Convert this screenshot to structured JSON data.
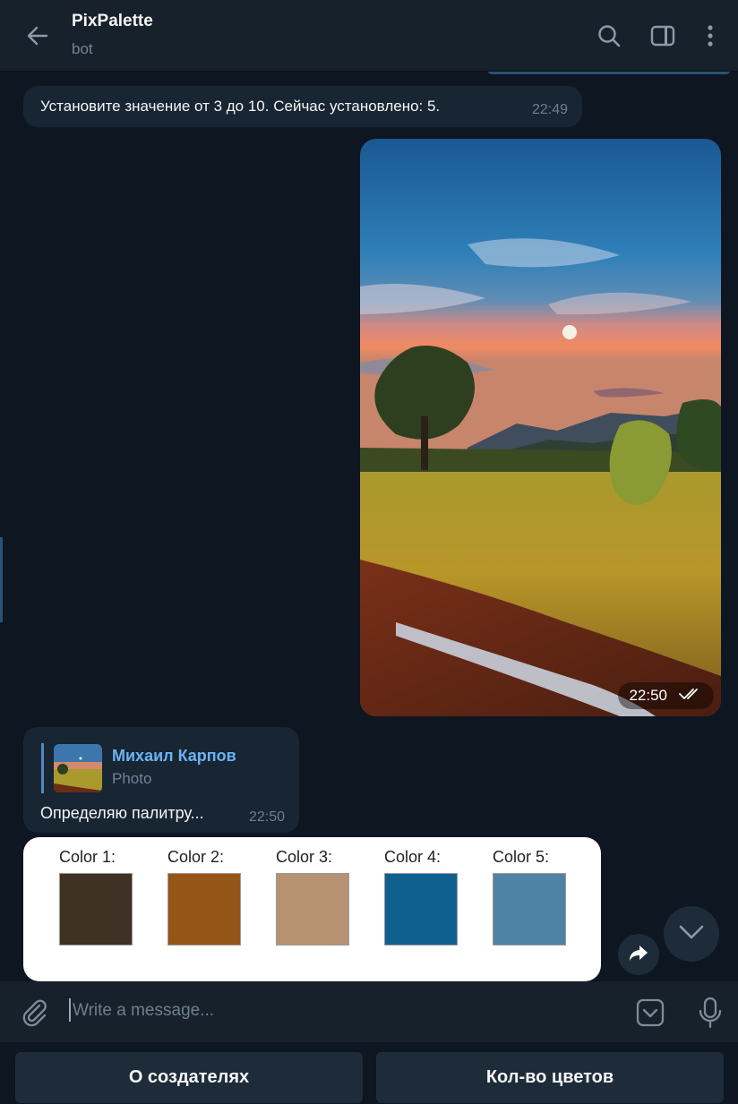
{
  "header": {
    "title": "PixPalette",
    "subtitle": "bot",
    "icons": [
      "back-arrow-icon",
      "search-icon",
      "sidebar-toggle-icon",
      "more-vertical-icon"
    ]
  },
  "messages": {
    "m1": {
      "text": "Установите значение от 3 до 10. Сейчас установлено: 5.",
      "time": "22:49"
    },
    "photo": {
      "time": "22:50",
      "status": "read"
    },
    "m3": {
      "reply_name": "Михаил Карпов",
      "reply_type": "Photo",
      "text": "Определяю палитру...",
      "time": "22:50"
    }
  },
  "palette": {
    "colors": [
      {
        "label": "Color 1:",
        "hex": "#3f3123"
      },
      {
        "label": "Color 2:",
        "hex": "#955516"
      },
      {
        "label": "Color 3:",
        "hex": "#b69272"
      },
      {
        "label": "Color 4:",
        "hex": "#0f6090"
      },
      {
        "label": "Color 5:",
        "hex": "#4f83a6"
      }
    ]
  },
  "composer": {
    "placeholder": "Write a message..."
  },
  "keyboard": {
    "about": "О создателях",
    "count": "Кол-во цветов"
  },
  "theme": {
    "background": "#0e1621",
    "header": "#17212b",
    "incoming_bubble": "#182533",
    "accent": "#6ab3f3"
  }
}
